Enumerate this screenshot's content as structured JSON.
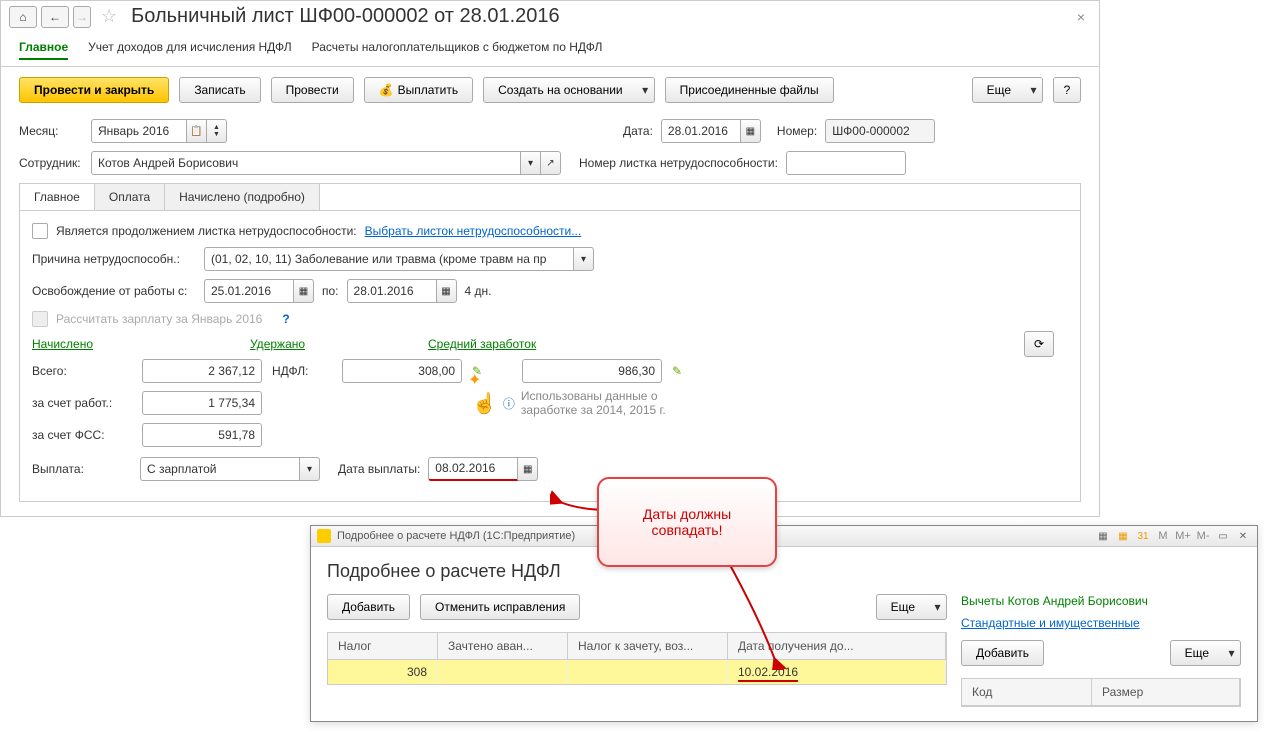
{
  "header": {
    "title": "Больничный лист ШФ00-000002 от 28.01.2016"
  },
  "navTabs": {
    "main": "Главное",
    "income": "Учет доходов для исчисления НДФЛ",
    "budget": "Расчеты налогоплательщиков с бюджетом по НДФЛ"
  },
  "toolbar": {
    "postClose": "Провести и закрыть",
    "save": "Записать",
    "post": "Провести",
    "pay": "Выплатить",
    "createBased": "Создать на основании",
    "attached": "Присоединенные файлы",
    "more": "Еще",
    "help": "?"
  },
  "form": {
    "monthLabel": "Месяц:",
    "monthValue": "Январь 2016",
    "dateLabel": "Дата:",
    "dateValue": "28.01.2016",
    "numberLabel": "Номер:",
    "numberValue": "ШФ00-000002",
    "employeeLabel": "Сотрудник:",
    "employeeValue": "Котов Андрей Борисович",
    "sickNumberLabel": "Номер листка нетрудоспособности:",
    "sickNumberValue": ""
  },
  "subTabs": {
    "main": "Главное",
    "payment": "Оплата",
    "accrued": "Начислено (подробно)"
  },
  "mainTab": {
    "continuationLabel": "Является продолжением листка нетрудоспособности:",
    "selectSheetLink": "Выбрать листок нетрудоспособности...",
    "reasonLabel": "Причина нетрудоспособн.:",
    "reasonValue": "(01, 02, 10, 11) Заболевание или травма (кроме травм на пр",
    "releaseLabel": "Освобождение от работы с:",
    "releaseFrom": "25.01.2016",
    "toLabel": "по:",
    "releaseTo": "28.01.2016",
    "daysText": "4 дн.",
    "calcSalaryLabel": "Рассчитать зарплату за Январь 2016",
    "accruedHdr": "Начислено",
    "withheldHdr": "Удержано",
    "avgEarnHdr": "Средний заработок",
    "totalLabel": "Всего:",
    "totalValue": "2 367,12",
    "ndflLabel": "НДФЛ:",
    "ndflValue": "308,00",
    "avgValue": "986,30",
    "employerLabel": "за счет работ.:",
    "employerValue": "1 775,34",
    "fssLabel": "за счет ФСС:",
    "fssValue": "591,78",
    "infoText": "Использованы данные о заработке за  2014,   2015 г.",
    "payoutLabel": "Выплата:",
    "payoutValue": "С зарплатой",
    "payoutDateLabel": "Дата выплаты:",
    "payoutDateValue": "08.02.2016"
  },
  "callout": {
    "text": "Даты должны совпадать!"
  },
  "subWindow": {
    "title": "Подробнее о расчете НДФЛ  (1С:Предприятие)",
    "heading": "Подробнее о расчете НДФЛ",
    "add": "Добавить",
    "cancel": "Отменить исправления",
    "more": "Еще",
    "table": {
      "col1": "Налог",
      "col2": "Зачтено аван...",
      "col3": "Налог к зачету, воз...",
      "col4": "Дата получения до...",
      "row1": {
        "tax": "308",
        "date": "10.02.2016"
      }
    },
    "side": {
      "name": "Вычеты Котов Андрей Борисович",
      "link": "Стандартные и имущественные",
      "add": "Добавить",
      "more": "Еще",
      "col1": "Код",
      "col2": "Размер"
    },
    "winIcons": {
      "m": "M",
      "mplus": "M+",
      "mminus": "M-"
    }
  }
}
